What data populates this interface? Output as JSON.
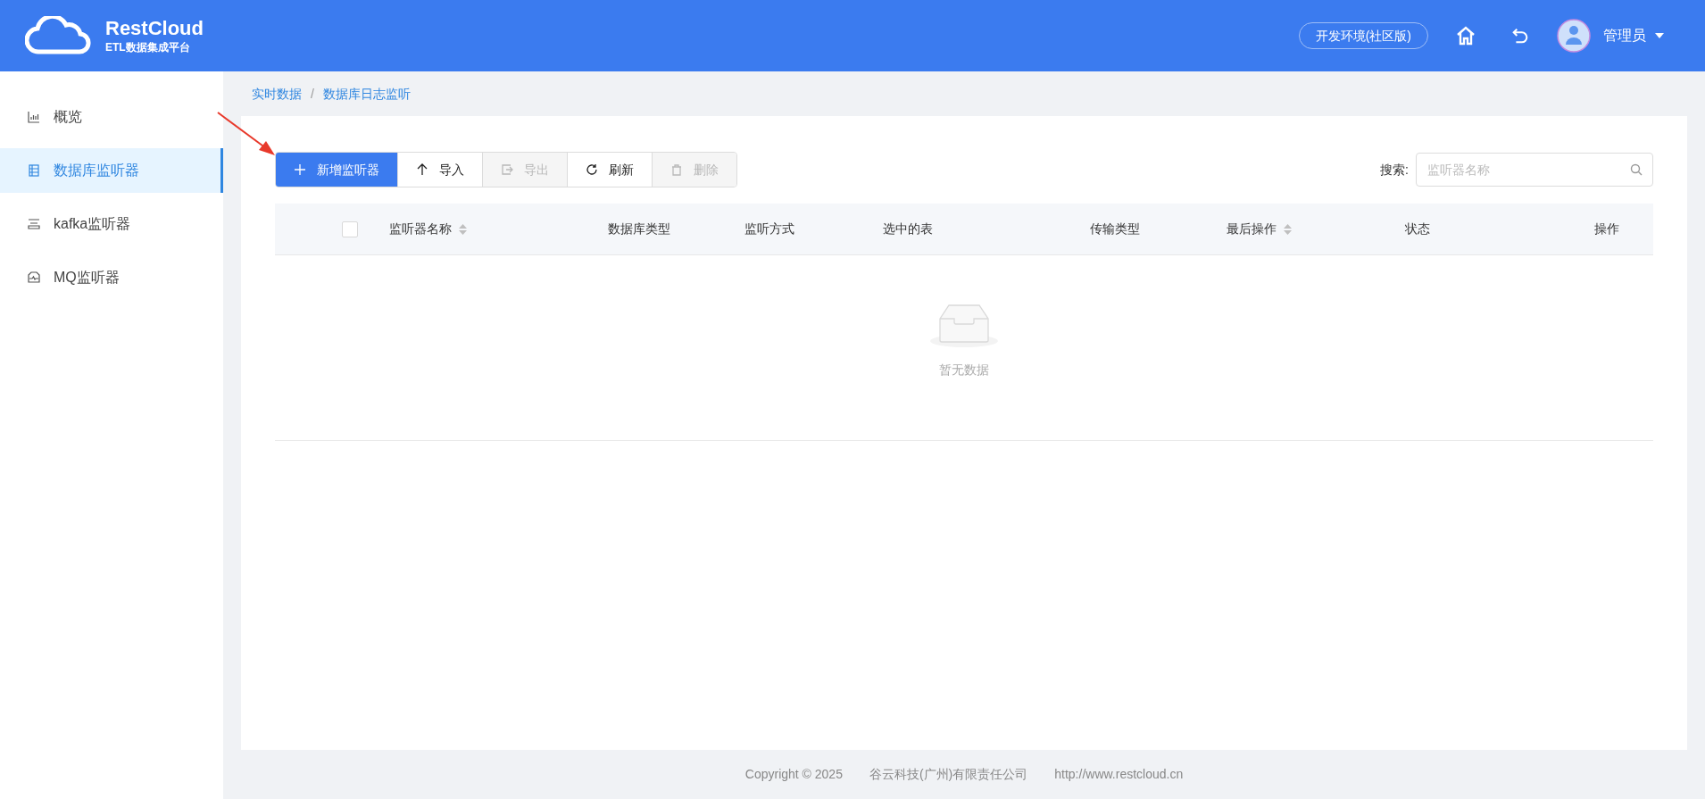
{
  "header": {
    "logo_title": "RestCloud",
    "logo_subtitle": "ETL数据集成平台",
    "environment": "开发环境(社区版)",
    "user": "管理员"
  },
  "sidebar": {
    "items": [
      {
        "label": "概览",
        "kind": "chart",
        "selected": false
      },
      {
        "label": "数据库监听器",
        "kind": "database",
        "selected": true
      },
      {
        "label": "kafka监听器",
        "kind": "list",
        "selected": false
      },
      {
        "label": "MQ监听器",
        "kind": "monitor",
        "selected": false
      }
    ]
  },
  "breadcrumb": {
    "items": [
      "实时数据",
      "数据库日志监听"
    ],
    "separator": "/"
  },
  "toolbar": {
    "buttons": [
      {
        "label": "新增监听器",
        "kind": "plus",
        "primary": true,
        "disabled": false
      },
      {
        "label": "导入",
        "kind": "up",
        "primary": false,
        "disabled": false
      },
      {
        "label": "导出",
        "kind": "export",
        "primary": false,
        "disabled": true
      },
      {
        "label": "刷新",
        "kind": "refresh",
        "primary": false,
        "disabled": false
      },
      {
        "label": "删除",
        "kind": "trash",
        "primary": false,
        "disabled": true
      }
    ],
    "search_label": "搜索:",
    "search": {
      "placeholder": "监听器名称"
    }
  },
  "table": {
    "select_all": {
      "checked": false
    },
    "columns": [
      {
        "label": "监听器名称",
        "sortable": true
      },
      {
        "label": "数据库类型",
        "sortable": false
      },
      {
        "label": "监听方式",
        "sortable": false
      },
      {
        "label": "选中的表",
        "sortable": false
      },
      {
        "label": "传输类型",
        "sortable": false
      },
      {
        "label": "最后操作",
        "sortable": true
      },
      {
        "label": "状态",
        "sortable": false
      },
      {
        "label": "操作",
        "sortable": false
      }
    ],
    "empty_text": "暂无数据"
  },
  "footer": [
    "Copyright © 2025",
    "谷云科技(广州)有限责任公司",
    "http://www.restcloud.cn"
  ]
}
